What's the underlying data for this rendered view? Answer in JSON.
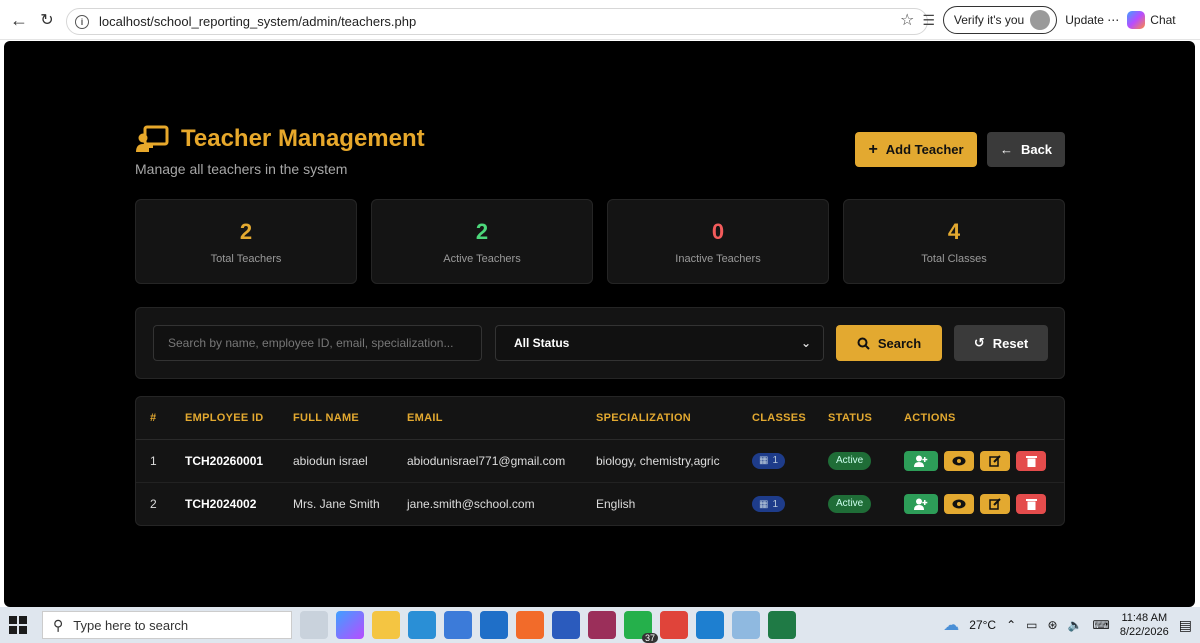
{
  "browser": {
    "url": "localhost/school_reporting_system/admin/teachers.php",
    "verify_label": "Verify it's you",
    "update_label": "Update",
    "chat_label": "Chat"
  },
  "header": {
    "title": "Teacher Management",
    "subtitle": "Manage all teachers in the system",
    "add_label": "Add Teacher",
    "back_label": "Back"
  },
  "stats": [
    {
      "value": "2",
      "label": "Total Teachers",
      "color": "#e3a930"
    },
    {
      "value": "2",
      "label": "Active Teachers",
      "color": "#4cd77a"
    },
    {
      "value": "0",
      "label": "Inactive Teachers",
      "color": "#f25b5b"
    },
    {
      "value": "4",
      "label": "Total Classes",
      "color": "#e3a930"
    }
  ],
  "filters": {
    "search_placeholder": "Search by name, employee ID, email, specialization...",
    "status_value": "All Status",
    "search_label": "Search",
    "reset_label": "Reset"
  },
  "table": {
    "columns": [
      "#",
      "EMPLOYEE ID",
      "FULL NAME",
      "EMAIL",
      "SPECIALIZATION",
      "CLASSES",
      "STATUS",
      "ACTIONS"
    ],
    "rows": [
      {
        "num": "1",
        "employee_id": "TCH20260001",
        "full_name": "abiodun israel",
        "email": "abiodunisrael771@gmail.com",
        "specialization": "biology, chemistry,agric",
        "classes": "1",
        "status": "Active"
      },
      {
        "num": "2",
        "employee_id": "TCH2024002",
        "full_name": "Mrs. Jane Smith",
        "email": "jane.smith@school.com",
        "specialization": "English",
        "classes": "1",
        "status": "Active"
      }
    ]
  },
  "taskbar": {
    "search_placeholder": "Type here to search",
    "weather": "27°C",
    "time": "11:48 AM",
    "date": "8/22/2026",
    "badge_count": "37"
  }
}
